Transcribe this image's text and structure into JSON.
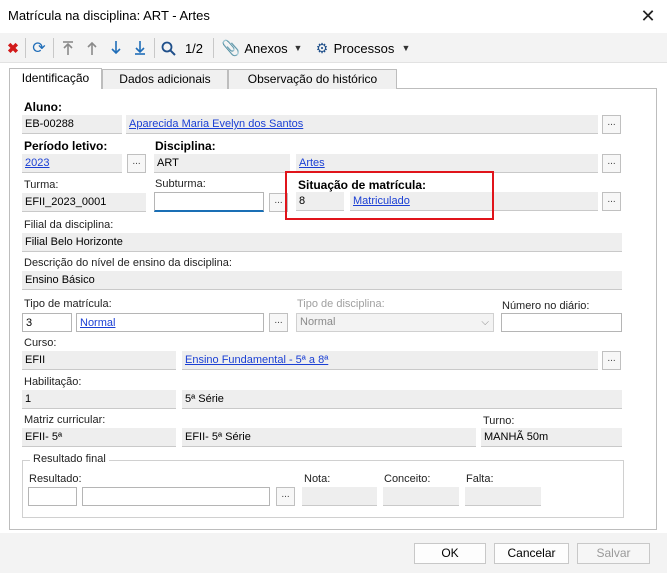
{
  "window": {
    "title": "Matrícula na disciplina: ART - Artes"
  },
  "toolbar": {
    "counter": "1/2",
    "anexos_label": "Anexos",
    "processos_label": "Processos"
  },
  "tabs": [
    {
      "label": "Identificação"
    },
    {
      "label": "Dados adicionais"
    },
    {
      "label": "Observação do histórico"
    }
  ],
  "form": {
    "aluno_label": "Aluno:",
    "aluno_code": "EB-00288",
    "aluno_name": "Aparecida Maria Evelyn dos Santos",
    "periodo_label": "Período letivo:",
    "periodo_value": "2023",
    "disciplina_label": "Disciplina:",
    "disciplina_code": "ART",
    "disciplina_name": "Artes",
    "turma_label": "Turma:",
    "turma_value": "EFII_2023_0001",
    "subturma_label": "Subturma:",
    "subturma_value": "",
    "situacao_label": "Situação de matrícula:",
    "situacao_code": "8",
    "situacao_name": "Matriculado",
    "filial_label": "Filial da disciplina:",
    "filial_value": "Filial Belo Horizonte",
    "nivel_label": "Descrição do nível de ensino da disciplina:",
    "nivel_value": "Ensino Básico",
    "tipo_matricula_label": "Tipo de matrícula:",
    "tipo_matricula_code": "3",
    "tipo_matricula_name": "Normal",
    "tipo_disciplina_label": "Tipo de disciplina:",
    "tipo_disciplina_value": "Normal",
    "numero_diario_label": "Número no diário:",
    "numero_diario_value": "",
    "curso_label": "Curso:",
    "curso_code": "EFII",
    "curso_name": "Ensino Fundamental - 5ª a 8ª",
    "habilitacao_label": "Habilitação:",
    "habilitacao_code": "1",
    "habilitacao_name": "5ª Série",
    "matriz_label": "Matriz curricular:",
    "matriz_code": "EFII- 5ª",
    "matriz_name": "EFII- 5ª Série",
    "turno_label": "Turno:",
    "turno_value": "MANHÃ 50m",
    "resultado_final_label": "Resultado final",
    "resultado_label": "Resultado:",
    "resultado_code": "",
    "resultado_name": "",
    "nota_label": "Nota:",
    "conceito_label": "Conceito:",
    "falta_label": "Falta:"
  },
  "ellipsis": "...",
  "footer": {
    "ok_label": "OK",
    "cancel_label": "Cancelar",
    "save_label": "Salvar"
  }
}
